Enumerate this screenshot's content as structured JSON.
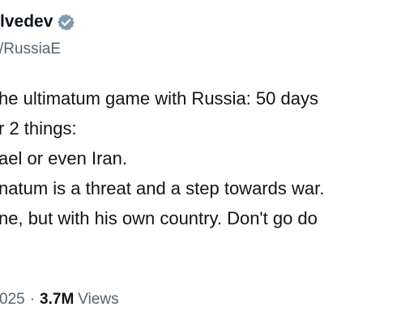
{
  "author": {
    "name": "lvedev",
    "handle": "/RussiaE",
    "verified_color": "#829aab"
  },
  "tweet": {
    "lines": [
      "he ultimatum game with Russia: 50 days",
      "r 2 things:",
      "ael or even Iran.",
      "natum is a threat and a step towards war.",
      "ne, but with his own country. Don't go do"
    ]
  },
  "meta": {
    "date": "025",
    "separator": "·",
    "views_count": "3.7M",
    "views_label": "Views"
  }
}
